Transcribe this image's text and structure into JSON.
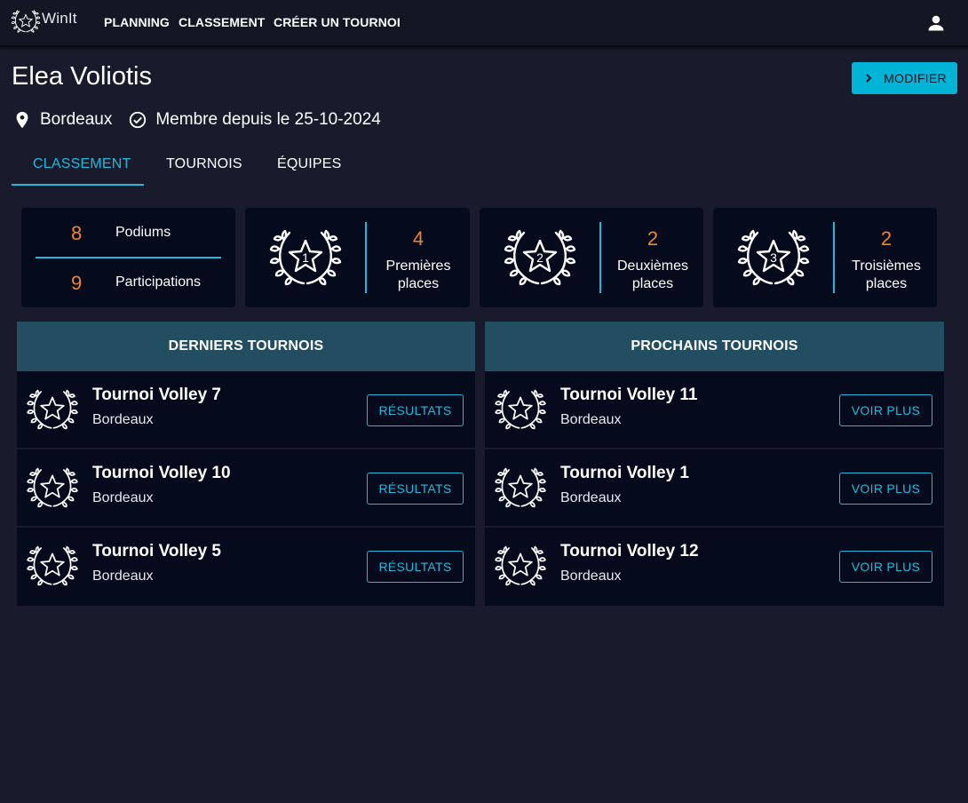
{
  "app": {
    "logo_text": "WinIt",
    "nav": [
      "PLANNING",
      "CLASSEMENT",
      "CRÉER UN TOURNOI"
    ]
  },
  "profile": {
    "name": "Elea Voliotis",
    "modify_label": "MODIFIER",
    "city": "Bordeaux",
    "member_since": "Membre depuis le 25-10-2024"
  },
  "tabs": [
    "CLASSEMENT",
    "TOURNOIS",
    "ÉQUIPES"
  ],
  "stats": {
    "podiums_value": "8",
    "podiums_label": "Podiums",
    "participations_value": "9",
    "participations_label": "Participations",
    "places": [
      {
        "rank": "1",
        "value": "4",
        "label_line1": "Premières",
        "label_line2": "places"
      },
      {
        "rank": "2",
        "value": "2",
        "label_line1": "Deuxièmes",
        "label_line2": "places"
      },
      {
        "rank": "3",
        "value": "2",
        "label_line1": "Troisièmes",
        "label_line2": "places"
      }
    ]
  },
  "last_tournaments": {
    "title": "DERNIERS TOURNOIS",
    "button_label": "RÉSULTATS",
    "items": [
      {
        "name": "Tournoi Volley 7",
        "city": "Bordeaux"
      },
      {
        "name": "Tournoi Volley 10",
        "city": "Bordeaux"
      },
      {
        "name": "Tournoi Volley 5",
        "city": "Bordeaux"
      }
    ]
  },
  "next_tournaments": {
    "title": "PROCHAINS TOURNOIS",
    "button_label": "VOIR PLUS",
    "items": [
      {
        "name": "Tournoi Volley 11",
        "city": "Bordeaux"
      },
      {
        "name": "Tournoi Volley 1",
        "city": "Bordeaux"
      },
      {
        "name": "Tournoi Volley 12",
        "city": "Bordeaux"
      }
    ]
  },
  "colors": {
    "background": "#191b2c",
    "card": "#050b1c",
    "accent": "#22b8d9",
    "number": "#f0852e",
    "panel_header": "#234e62",
    "button": "#00b4d8"
  }
}
